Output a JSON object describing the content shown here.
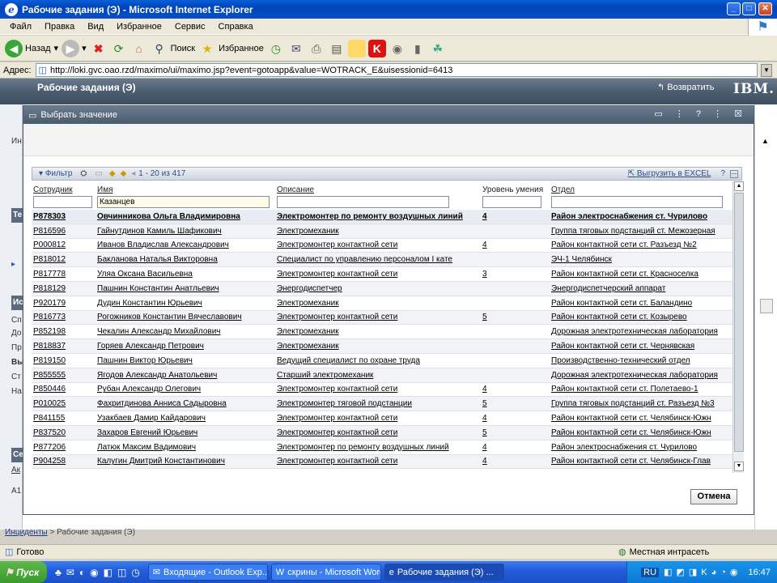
{
  "window": {
    "title": "Рабочие задания (Э) - Microsoft Internet Explorer"
  },
  "menu": [
    "Файл",
    "Правка",
    "Вид",
    "Избранное",
    "Сервис",
    "Справка"
  ],
  "toolbar": {
    "back": "Назад",
    "search": "Поиск",
    "favorites": "Избранное"
  },
  "address": {
    "label": "Адрес:",
    "url": "http://loki.gvc.oao.rzd/maximo/ui/maximo.jsp?event=gotoapp&value=WOTRACK_E&uisessionid=6413"
  },
  "app": {
    "title": "Рабочие задания (Э)",
    "return_label": "Возвратить",
    "brand": "IBM."
  },
  "sidebar": {
    "labels": [
      "Ин",
      "Те",
      "Ис",
      "Сп",
      "До",
      "Пр",
      "Вы",
      "Ст",
      "На",
      "Се",
      "Ак",
      "А1"
    ]
  },
  "modal": {
    "title": "Выбрать значение",
    "filter_label": "Фильтр",
    "pager": "1 - 20 из 417",
    "export_label": "Выгрузить в EXCEL",
    "cancel_label": "Отмена",
    "columns": [
      "Сотрудник",
      "Имя",
      "Описание",
      "Уровень умения",
      "Отдел"
    ],
    "filter_values": {
      "c1": "",
      "c2": "Казанцев",
      "c3": "",
      "c4": "",
      "c5": ""
    },
    "rows": [
      [
        "P878303",
        "Овчинникова Ольга Владимировна",
        "Электромонтер по ремонту воздушных линий",
        "4",
        "Район электроснабжения ст. Чурилово"
      ],
      [
        "P816596",
        "Гайнутдинов Камиль Шафикович",
        "Электромеханик",
        "",
        "Группа тяговых подстанций ст. Межозерная"
      ],
      [
        "P000812",
        "Иванов Владислав Александрович",
        "Электромонтер контактной сети",
        "4",
        "Район контактной сети ст. Разъезд №2"
      ],
      [
        "P818012",
        "Бакланова Наталья Викторовна",
        "Специалист по управлению персоналом I кате",
        "",
        "ЭЧ-1 Челябинск"
      ],
      [
        "P817778",
        "Уляа Оксана Васильевна",
        "Электромонтер контактной сети",
        "3",
        "Район контактной сети ст. Красноселка"
      ],
      [
        "P818129",
        "Пашнин Константин Анатльевич",
        "Энергодиспетчер",
        "",
        "Энергодиспетчерский аппарат"
      ],
      [
        "P920179",
        "Дудин Константин Юрьевич",
        "Электромеханик",
        "",
        "Район контактной сети ст. Баландино"
      ],
      [
        "P816773",
        "Рогожников Константин Вячеславович",
        "Электромонтер контактной сети",
        "5",
        "Район контактной сети ст. Козырево"
      ],
      [
        "P852198",
        "Чекалин Александр Михайлович",
        "Электромеханик",
        "",
        "Дорожная электротехническая лаборатория"
      ],
      [
        "P818837",
        "Горяев Александр Петрович",
        "Электромеханик",
        "",
        "Район контактной сети ст. Чернявская"
      ],
      [
        "P819150",
        "Пашнин Виктор Юрьевич",
        "Ведущий специалист по охране труда",
        "",
        "Производственно-технический отдел"
      ],
      [
        "P855555",
        "Ягодов Александр Анатольевич",
        "Старший электромеханик",
        "",
        "Дорожная электротехническая лаборатория"
      ],
      [
        "P850446",
        "Рубан Александр Олегович",
        "Электромонтер контактной сети",
        "4",
        "Район контактной сети ст. Полетаево-1"
      ],
      [
        "P010025",
        "Фахритдинова Анниса Садыровна",
        "Электромонтер тяговой подстанции",
        "5",
        "Группа тяговых подстанций ст. Разъезд №3"
      ],
      [
        "P841155",
        "Узакбаев Дамир Кайдарович",
        "Электромонтер контактной сети",
        "4",
        "Район контактной сети ст. Челябинск-Южн"
      ],
      [
        "P837520",
        "Захаров Евгений Юрьевич",
        "Электромонтер контактной сети",
        "5",
        "Район контактной сети ст. Челябинск-Южн"
      ],
      [
        "P877206",
        "Латюк Максим Вадимович",
        "Электромонтер по ремонту воздушных линий",
        "4",
        "Район электроснабжения ст. Чурилово"
      ],
      [
        "P904258",
        "Калугин Дмитрий Константинович",
        "Электромонтер контактной сети",
        "4",
        "Район контактной сети ст. Челябинск-Глав"
      ]
    ]
  },
  "breadcrumb": {
    "link": "Инциденты",
    "sep": " > ",
    "current": "Рабочие задания (Э)"
  },
  "status": {
    "left": "Готово",
    "zone": "Местная интрасеть"
  },
  "taskbar": {
    "start": "Пуск",
    "tasks": [
      "Входящие - Outlook Exp...",
      "скрины - Microsoft Word",
      "Рабочие задания (Э) ..."
    ],
    "lang": "RU",
    "time": "16:47"
  }
}
